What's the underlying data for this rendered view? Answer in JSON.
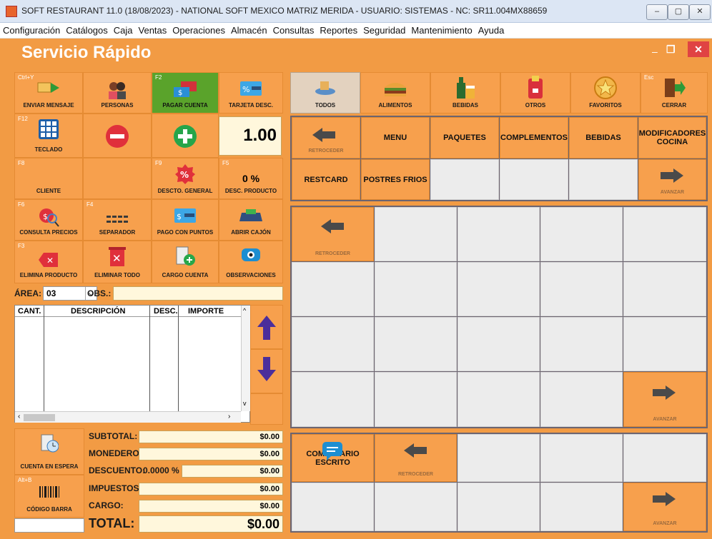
{
  "window": {
    "title": "SOFT RESTAURANT 11.0 (18/08/2023) - NATIONAL SOFT MEXICO MATRIZ MERIDA - USUARIO: SISTEMAS   -   NC: SR11.004MX88659",
    "minimize": "–",
    "maximize": "▢",
    "close": "✕"
  },
  "menu": [
    "Configuración",
    "Catálogos",
    "Caja",
    "Ventas",
    "Operaciones",
    "Almacén",
    "Consultas",
    "Reportes",
    "Seguridad",
    "Mantenimiento",
    "Ayuda"
  ],
  "app": {
    "title": "Servicio Rápido",
    "min": "–",
    "restore": "❐",
    "close": "✕"
  },
  "actions": {
    "enviar_mensaje": {
      "key": "Ctrl+Y",
      "label": "ENVIAR MENSAJE"
    },
    "personas": {
      "key": "",
      "label": "PERSONAS"
    },
    "pagar_cuenta": {
      "key": "F2",
      "label": "PAGAR CUENTA"
    },
    "tarjeta_desc": {
      "key": "",
      "label": "TARJETA DESC."
    },
    "teclado": {
      "key": "F12",
      "label": "TECLADO"
    },
    "quantity": "1.00",
    "cliente": {
      "key": "F8",
      "label": "CLIENTE"
    },
    "descto_general": {
      "key": "F9",
      "label": "DESCTO. GENERAL"
    },
    "desc_producto": {
      "key": "F5",
      "label": "DESC. PRODUCTO",
      "value": "0 %"
    },
    "consulta_precios": {
      "key": "F6",
      "label": "CONSULTA PRECIOS"
    },
    "separador": {
      "key": "F4",
      "label": "SEPARADOR"
    },
    "pago_puntos": {
      "key": "",
      "label": "PAGO CON PUNTOS"
    },
    "abrir_cajon": {
      "key": "",
      "label": "ABRIR CAJÓN"
    },
    "elimina_producto": {
      "key": "F3",
      "label": "ELIMINA PRODUCTO"
    },
    "eliminar_todo": {
      "key": "",
      "label": "ELIMINAR TODO"
    },
    "cargo_cuenta": {
      "key": "",
      "label": "CARGO CUENTA"
    },
    "observaciones": {
      "key": "",
      "label": "OBSERVACIONES"
    }
  },
  "area": {
    "label": "ÁREA:",
    "value": "03",
    "obs_label": "OBS.:"
  },
  "order_table": {
    "headers": [
      "CANT.",
      "DESCRIPCIÓN",
      "DESC.",
      "IMPORTE"
    ]
  },
  "totals": {
    "subtotal": {
      "label": "SUBTOTAL:",
      "value": "$0.00"
    },
    "monedero": {
      "label": "MONEDERO:",
      "value": "$0.00"
    },
    "descuento": {
      "label": "DESCUENTO:",
      "pct": "0.0000 %",
      "value": "$0.00"
    },
    "impuestos": {
      "label": "IMPUESTOS:",
      "value": "$0.00"
    },
    "cargo": {
      "label": "CARGO:",
      "value": "$0.00"
    },
    "total": {
      "label": "TOTAL:",
      "value": "$0.00"
    }
  },
  "left_bottom": {
    "cuenta_espera": "CUENTA EN ESPERA",
    "codigo_barra": {
      "key": "Alt+B",
      "label": "CÓDIGO BARRA"
    }
  },
  "filters": [
    {
      "label": "TODOS",
      "key": ""
    },
    {
      "label": "ALIMENTOS",
      "key": ""
    },
    {
      "label": "BEBIDAS",
      "key": ""
    },
    {
      "label": "OTROS",
      "key": ""
    },
    {
      "label": "FAVORITOS",
      "key": ""
    },
    {
      "label": "CERRAR",
      "key": "Esc"
    }
  ],
  "categories": {
    "retroceder": "RETROCEDER",
    "row1": [
      "MENU",
      "PAQUETES",
      "COMPLEMENTOS",
      "BEBIDAS",
      "MODIFICADORES COCINA"
    ],
    "row2": [
      "RESTCARD",
      "POSTRES FRIOS"
    ],
    "avanzar": "AVANZAR"
  },
  "products": {
    "retroceder": "RETROCEDER",
    "avanzar": "AVANZAR"
  },
  "comments": {
    "comentario": "COMENTARIO ESCRITO",
    "retroceder": "RETROCEDER",
    "avanzar": "AVANZAR"
  },
  "colors": {
    "accent": "#f29b44",
    "tile": "#f7a04d",
    "green": "#5aa32b",
    "panel": "#6c6470"
  }
}
